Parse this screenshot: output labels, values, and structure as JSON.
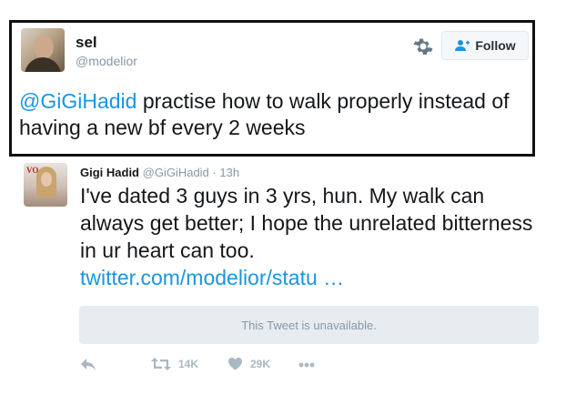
{
  "embedded_tweet": {
    "display_name": "sel",
    "handle": "@modelior",
    "follow_label": "Follow",
    "mention": "@GiGiHadid",
    "text": " practise how to walk properly instead of having a new bf every 2 weeks"
  },
  "reply_tweet": {
    "display_name": "Gigi Hadid",
    "handle": "@GiGiHadid",
    "separator": "·",
    "timestamp": "13h",
    "text": "I've dated 3 guys in 3 yrs, hun. My walk can always get better; I hope the unrelated bitterness in ur heart can too.",
    "link": "twitter.com/modelior/statu …",
    "quoted_unavailable": "This Tweet is unavailable.",
    "retweet_count": "14K",
    "like_count": "29K"
  },
  "icons": [
    "gear-icon",
    "follow-user-icon",
    "reply-icon",
    "retweet-icon",
    "heart-icon",
    "more-icon"
  ],
  "colors": {
    "link": "#1b95e0",
    "muted": "#8899a6",
    "action": "#aab8c2"
  }
}
